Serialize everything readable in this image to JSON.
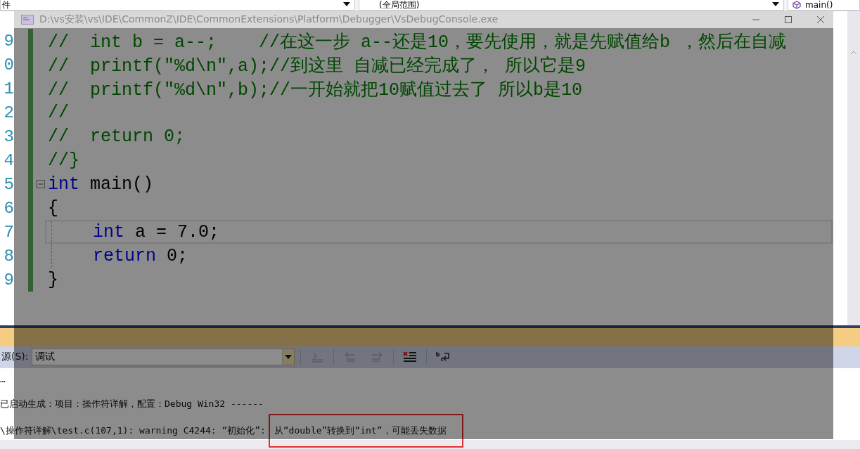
{
  "top_bar": {
    "left_dropdown": "件",
    "scope_dropdown": "(全局范围)",
    "member_dropdown": "main()"
  },
  "code_lines": [
    {
      "number": "9",
      "indented": false,
      "collapse": false,
      "current": false,
      "segments": [
        {
          "text": "//  int b = a--;    //在这一步 a--还是10，要先使用，就是先赋值给b ，然后在自减",
          "kind": "comment"
        }
      ]
    },
    {
      "number": "0",
      "indented": false,
      "collapse": false,
      "current": false,
      "segments": [
        {
          "text": "//  printf(\"%d\\n\",a);//到这里 自减已经完成了， 所以它是9",
          "kind": "comment"
        }
      ]
    },
    {
      "number": "1",
      "indented": false,
      "collapse": false,
      "current": false,
      "segments": [
        {
          "text": "//  printf(\"%d\\n\",b);//一开始就把10赋值过去了 所以b是10",
          "kind": "comment"
        }
      ]
    },
    {
      "number": "2",
      "indented": false,
      "collapse": false,
      "current": false,
      "segments": [
        {
          "text": "//",
          "kind": "comment"
        }
      ]
    },
    {
      "number": "3",
      "indented": false,
      "collapse": false,
      "current": false,
      "segments": [
        {
          "text": "//  return 0;",
          "kind": "comment"
        }
      ]
    },
    {
      "number": "4",
      "indented": false,
      "collapse": false,
      "current": false,
      "segments": [
        {
          "text": "//}",
          "kind": "comment"
        }
      ]
    },
    {
      "number": "5",
      "indented": false,
      "collapse": true,
      "current": false,
      "segments": [
        {
          "text": "int",
          "kind": "keyword"
        },
        {
          "text": " main()",
          "kind": "plain"
        }
      ]
    },
    {
      "number": "6",
      "indented": false,
      "collapse": false,
      "current": false,
      "segments": [
        {
          "text": "{",
          "kind": "plain"
        }
      ]
    },
    {
      "number": "7",
      "indented": true,
      "collapse": false,
      "current": true,
      "segments": [
        {
          "text": "int",
          "kind": "keyword"
        },
        {
          "text": " a = 7.0;",
          "kind": "plain"
        }
      ]
    },
    {
      "number": "8",
      "indented": true,
      "collapse": false,
      "current": false,
      "segments": [
        {
          "text": "return",
          "kind": "keyword"
        },
        {
          "text": " 0;",
          "kind": "plain"
        }
      ]
    },
    {
      "number": "9",
      "indented": false,
      "collapse": false,
      "current": false,
      "segments": [
        {
          "text": "}",
          "kind": "plain"
        }
      ]
    }
  ],
  "console_window": {
    "title": "D:\\vs安装\\vs\\IDE\\CommonZ\\IDE\\CommonExtensions\\Platform\\Debugger\\VsDebugConsole.exe"
  },
  "output_panel": {
    "source_label": "源(S):",
    "source_value": "调试",
    "lines": [
      {
        "segments": [
          {
            "text": "…",
            "boxed": false
          }
        ]
      },
      {
        "segments": [
          {
            "text": "已启动生成：项目：操作符详解，配置：Debug Win32 ------",
            "boxed": false
          }
        ]
      },
      {
        "segments": [
          {
            "text": "\\操作符详解\\test.c(107,1): warning C4244: “初始化”: ",
            "boxed": false
          },
          {
            "text": "从“double”转换到“int”，可能丢失数据",
            "boxed": true
          }
        ]
      }
    ]
  }
}
